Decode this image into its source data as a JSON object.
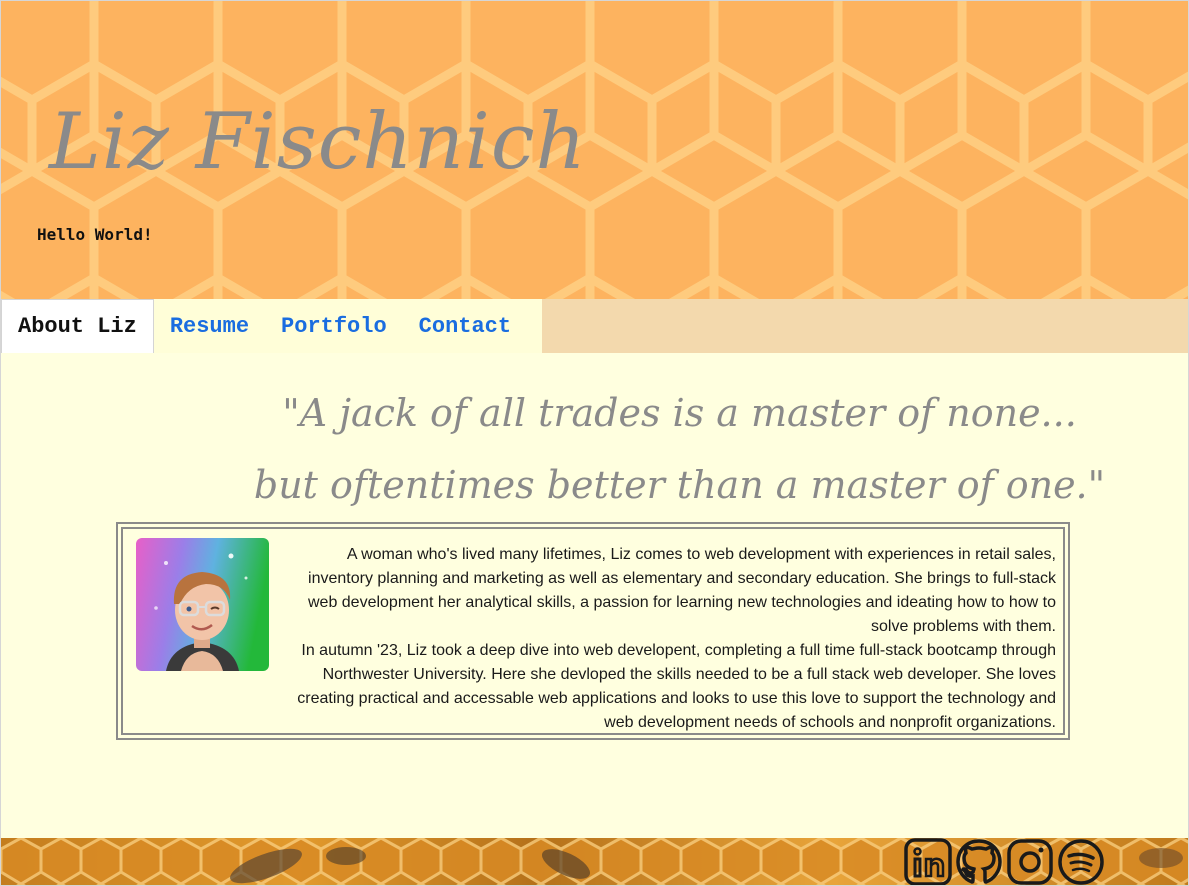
{
  "header": {
    "site_title": "Liz Fischnich",
    "tagline": "Hello World!"
  },
  "nav": {
    "tabs": [
      {
        "label": "About Liz",
        "active": true
      },
      {
        "label": "Resume",
        "active": false
      },
      {
        "label": "Portfolo",
        "active": false
      },
      {
        "label": "Contact",
        "active": false
      }
    ]
  },
  "main": {
    "quote": {
      "line1": "\"A jack of all trades is a master of none...",
      "line2": "but oftentimes better than a master of one.\""
    },
    "bio": {
      "paragraph1": "A woman who's lived many lifetimes, Liz comes to web development with experiences in retail sales, inventory planning and marketing as well as elementary and secondary education. She brings to full-stack web development her analytical skills, a passion for learning new technologies and ideating how to how to solve problems with them.",
      "paragraph2": "In autumn '23, Liz took a deep dive into web developent, completing a full time full-stack bootcamp through Northwester University. Here she devloped the skills needed to be a full stack web developer. She loves creating practical and accessable web applications and looks to use this love to support the technology and web development needs of schools and nonprofit organizations."
    }
  },
  "footer": {
    "social_icons": [
      "linkedin-icon",
      "github-icon",
      "instagram-icon",
      "spotify-icon"
    ]
  },
  "colors": {
    "header_bg": "#fdb35f",
    "honeycomb_line": "#fecb7e",
    "title_gray": "#8a8a8a",
    "nav_bg": "#f3d9ad",
    "tab_bg": "#fffed8",
    "tab_link": "#1a6de0",
    "main_bg": "#ffffdf",
    "bio_border": "#8a8a8a"
  }
}
